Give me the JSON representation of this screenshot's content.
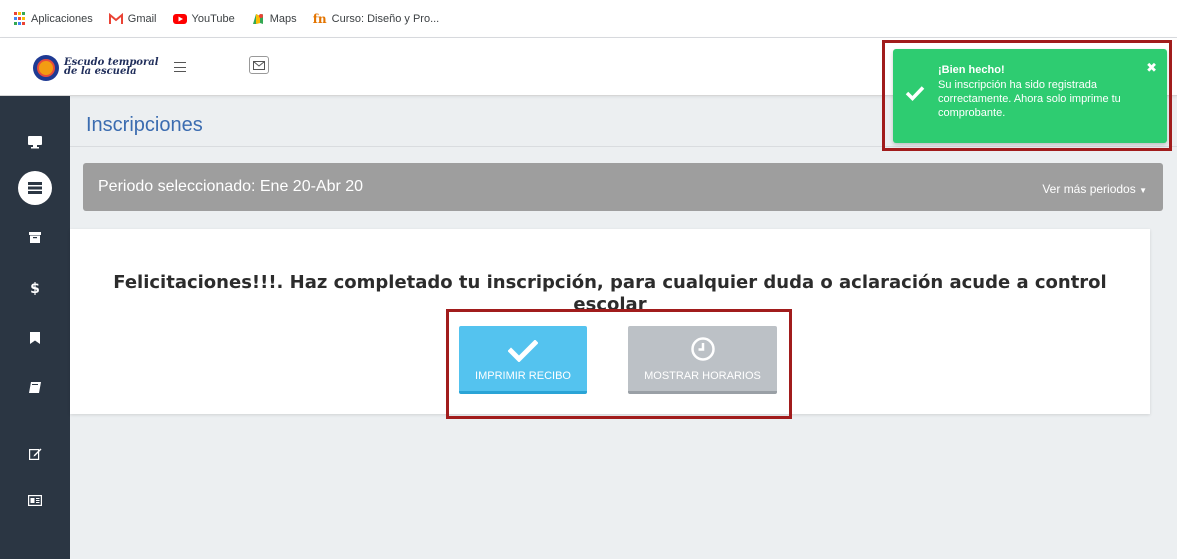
{
  "bookmarks": [
    {
      "label": "Aplicaciones",
      "icon": "apps-grid-icon"
    },
    {
      "label": "Gmail",
      "icon": "gmail-icon"
    },
    {
      "label": "YouTube",
      "icon": "youtube-icon"
    },
    {
      "label": "Maps",
      "icon": "maps-icon"
    },
    {
      "label": "Curso: Diseño y Pro...",
      "icon": "course-icon"
    }
  ],
  "header": {
    "brand_line1": "Escudo temporal",
    "brand_line2": "de la escuela"
  },
  "sidebar": {
    "items": [
      {
        "icon": "monitor-icon"
      },
      {
        "icon": "list-icon",
        "active": true
      },
      {
        "icon": "archive-icon"
      },
      {
        "icon": "dollar-icon"
      },
      {
        "icon": "bookmark-icon"
      },
      {
        "icon": "book-icon"
      },
      {
        "icon": "edit-icon"
      },
      {
        "icon": "id-card-icon"
      }
    ]
  },
  "page": {
    "title": "Inscripciones",
    "period_label": "Periodo seleccionado: Ene 20-Abr 20",
    "period_more": "Ver más periodos"
  },
  "panel": {
    "message": "Felicitaciones!!!. Haz completado tu inscripción, para cualquier duda o aclaración acude a control escolar",
    "print_button": "IMPRIMIR RECIBO",
    "schedule_button": "MOSTRAR HORARIOS"
  },
  "toast": {
    "title": "¡Bien hecho!",
    "message": "Su inscripción ha sido registrada correctamente. Ahora solo imprime tu comprobante.",
    "close": "✖"
  },
  "colors": {
    "sidebar": "#2b3643",
    "title": "#3b6cb0",
    "period_bar": "#9e9e9e",
    "print_button": "#54c3ef",
    "schedule_button": "#bcc1c6",
    "toast": "#2ecc71",
    "highlight": "#a11c1c"
  }
}
